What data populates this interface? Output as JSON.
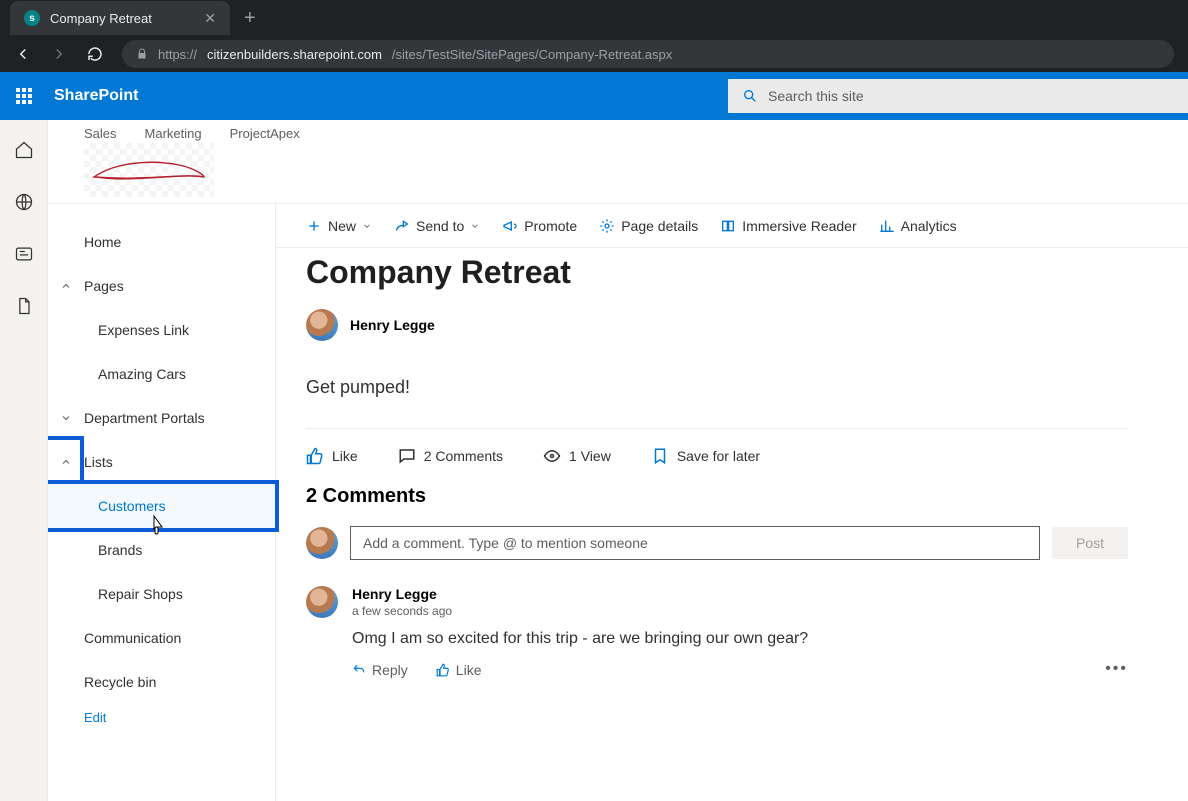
{
  "browser": {
    "tab_title": "Company Retreat",
    "url_prefix": "https://",
    "url_host": "citizenbuilders.sharepoint.com",
    "url_path": "/sites/TestSite/SitePages/Company-Retreat.aspx"
  },
  "suite": {
    "app": "SharePoint",
    "search_placeholder": "Search this site"
  },
  "topnav": {
    "items": [
      "Sales",
      "Marketing",
      "ProjectApex"
    ]
  },
  "leftnav": {
    "home": "Home",
    "pages": "Pages",
    "pages_children": [
      "Expenses Link",
      "Amazing Cars"
    ],
    "dept": "Department Portals",
    "lists": "Lists",
    "lists_children": [
      "Customers",
      "Brands",
      "Repair Shops"
    ],
    "comm": "Communication",
    "recycle": "Recycle bin",
    "edit": "Edit"
  },
  "cmd": {
    "new": "New",
    "send": "Send to",
    "promote": "Promote",
    "details": "Page details",
    "reader": "Immersive Reader",
    "analytics": "Analytics"
  },
  "page": {
    "title": "Company Retreat",
    "author": "Henry Legge",
    "body": "Get pumped!",
    "like": "Like",
    "comments_count": "2 Comments",
    "views": "1 View",
    "save": "Save for later",
    "comments_header": "2 Comments",
    "comment_placeholder": "Add a comment. Type @ to mention someone",
    "post": "Post"
  },
  "comment1": {
    "author": "Henry Legge",
    "time": "a few seconds ago",
    "text": "Omg I am so excited for this trip - are we bringing our own gear?",
    "reply": "Reply",
    "like": "Like"
  }
}
